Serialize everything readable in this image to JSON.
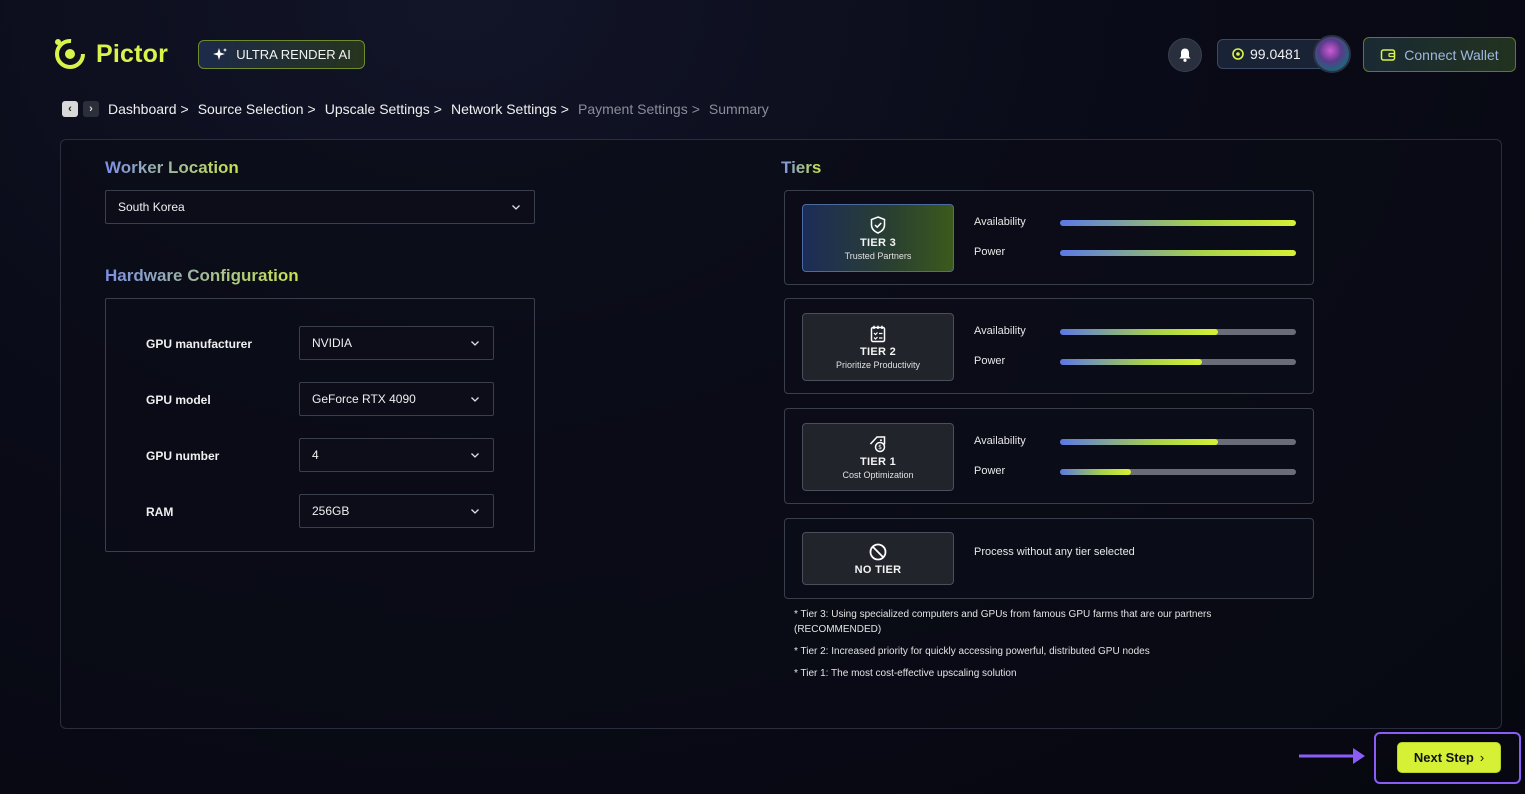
{
  "header": {
    "brand": "Pictor",
    "badge": "ULTRA RENDER AI",
    "balance": "99.0481",
    "connect_wallet": "Connect Wallet"
  },
  "breadcrumb": [
    {
      "label": "Dashboard",
      "sep": ">",
      "active": true
    },
    {
      "label": "Source Selection",
      "sep": ">",
      "active": true
    },
    {
      "label": "Upscale Settings",
      "sep": ">",
      "active": true
    },
    {
      "label": "Network Settings",
      "sep": ">",
      "active": true
    },
    {
      "label": "Payment Settings",
      "sep": ">",
      "active": false
    },
    {
      "label": "Summary",
      "sep": "",
      "active": false
    }
  ],
  "worker_location": {
    "title": "Worker Location",
    "value": "South Korea"
  },
  "hardware": {
    "title": "Hardware Configuration",
    "fields": [
      {
        "label": "GPU manufacturer",
        "value": "NVIDIA"
      },
      {
        "label": "GPU model",
        "value": "GeForce RTX 4090"
      },
      {
        "label": "GPU number",
        "value": "4"
      },
      {
        "label": "RAM",
        "value": "256GB"
      }
    ]
  },
  "tiers": {
    "title": "Tiers",
    "availability_label": "Availability",
    "power_label": "Power",
    "items": [
      {
        "name": "TIER 3",
        "sub": "Trusted Partners",
        "availability": 1.0,
        "power": 1.0,
        "selected": true,
        "icon": "shield-check-icon"
      },
      {
        "name": "TIER 2",
        "sub": "Prioritize Productivity",
        "availability": 0.67,
        "power": 0.6,
        "selected": false,
        "icon": "checklist-icon"
      },
      {
        "name": "TIER 1",
        "sub": "Cost Optimization",
        "availability": 0.67,
        "power": 0.3,
        "selected": false,
        "icon": "price-tag-icon"
      }
    ],
    "no_tier": {
      "name": "NO TIER",
      "text": "Process without any tier selected",
      "icon": "prohibited-icon"
    },
    "notes": [
      "* Tier 3: Using specialized computers and GPUs from famous GPU farms that are our partners (RECOMMENDED)",
      "* Tier 2: Increased priority for quickly accessing powerful, distributed GPU nodes",
      "* Tier 1: The most cost-effective upscaling solution"
    ]
  },
  "next_step": "Next Step",
  "colors": {
    "accent": "#d6f035",
    "highlight": "#8b5cf6",
    "gradient_start": "#5b78e6"
  }
}
